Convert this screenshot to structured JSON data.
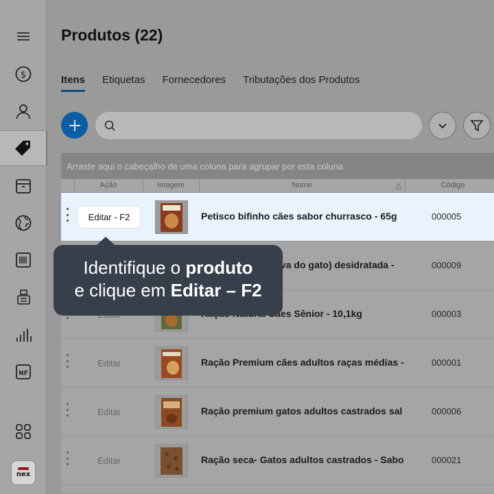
{
  "page": {
    "title": "Produtos (22)"
  },
  "tabs": [
    {
      "label": "Itens",
      "active": true
    },
    {
      "label": "Etiquetas"
    },
    {
      "label": "Fornecedores"
    },
    {
      "label": "Tributações dos Produtos"
    }
  ],
  "grid": {
    "group_hint": "Arraste aqui o cabeçalho de uma coluna para agrupar por esta coluna",
    "columns": {
      "action": "Ação",
      "image": "Imagem",
      "name": "Nome",
      "sort_indicator": "△",
      "code": "Código"
    },
    "selected_edit_label": "Editar - F2",
    "edit_label": "Editar",
    "rows": [
      {
        "name": "Petisco bifinho cães sabor churrasco - 65g",
        "code": "000005",
        "selected": true
      },
      {
        "name": "Ração Natural (erva do gato) desidratada - ",
        "code": "000009"
      },
      {
        "name": "Ração Natural Cães Sênior - 10,1kg",
        "code": "000003"
      },
      {
        "name": "Ração Premium cães adultos raças médias -",
        "code": "000001"
      },
      {
        "name": "Ração premium gatos adultos castrados sal",
        "code": "000006"
      },
      {
        "name": "Ração seca- Gatos adultos castrados - Sabo",
        "code": "000021"
      }
    ]
  },
  "tooltip": {
    "line1_plain": "Identifique o ",
    "line1_bold": "produto",
    "line2_plain": "e clique em ",
    "line2_bold": "Editar – F2"
  },
  "sidebar": {
    "icons": [
      "menu-icon",
      "dollar-icon",
      "user-icon",
      "tag-icon",
      "box-icon",
      "globe-icon",
      "barcode-icon",
      "register-icon",
      "chart-icon",
      "nf-icon",
      "apps-icon"
    ],
    "nf_label": "NF",
    "logo_text": "nex"
  },
  "colors": {
    "primary": "#0d5da6",
    "tooltip_bg": "#363f4a",
    "selected_row": "#e8f3fd"
  }
}
